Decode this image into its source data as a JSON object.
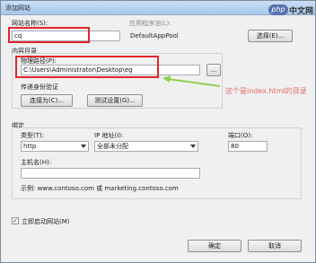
{
  "window": {
    "title": "添加网站"
  },
  "site": {
    "name_label": "网站名称(S):",
    "name_value": "cq",
    "pool_label": "应用程序池(L):",
    "pool_value": "DefaultAppPool",
    "select_button": "选择(E)..."
  },
  "content_dir": {
    "group_label": "内容目录",
    "physical_path_label": "物理路径(P):",
    "physical_path_value": "C:\\Users\\Administrator\\Desktop\\eg",
    "browse_button": "...",
    "passthrough_label": "传递身份验证",
    "connect_as_button": "连接为(C)...",
    "test_settings_button": "测试设置(G)..."
  },
  "annotation": {
    "text": "这个是index.html的目录",
    "color": "#e06a6a",
    "arrow_color": "#92d050"
  },
  "binding": {
    "group_label": "绑定",
    "type_label": "类型(T):",
    "type_value": "http",
    "ip_label": "IP 地址(I):",
    "ip_value": "全部未分配",
    "port_label": "端口(O):",
    "port_value": "80",
    "host_label": "主机名(H):",
    "host_value": "",
    "example": "示例: www.contoso.com 或 marketing.contoso.com"
  },
  "start_now": {
    "label": "立即启动网站(M)",
    "checked": true
  },
  "footer": {
    "ok_button": "确定",
    "cancel_button": "取消"
  },
  "watermark": {
    "php_text": "php",
    "site_text": "中文网"
  },
  "colors": {
    "highlight": "#e0262b"
  }
}
